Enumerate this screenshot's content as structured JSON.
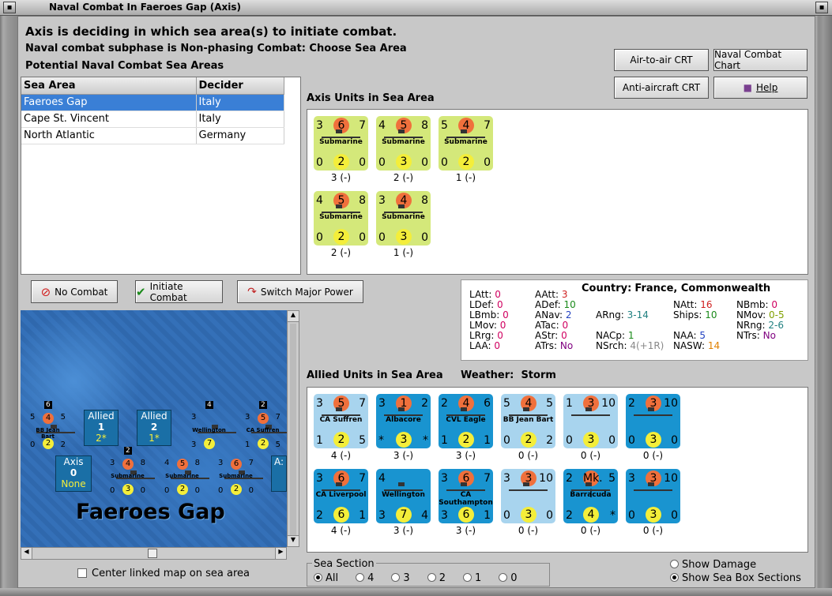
{
  "window": {
    "title": "Naval Combat In Faeroes Gap (Axis)"
  },
  "header": {
    "line1": "Axis is deciding in which sea area(s) to initiate combat.",
    "line2": "Naval combat subphase is Non-phasing Combat: Choose Sea Area",
    "line3": "Potential Naval Combat Sea Areas"
  },
  "buttons": {
    "air_to_air": "Air-to-air CRT",
    "naval_chart": "Naval Combat Chart",
    "anti_aircraft": "Anti-aircraft CRT",
    "help": "Help",
    "no_combat": "No Combat",
    "initiate": "Initiate Combat",
    "switch_power": "Switch Major Power"
  },
  "sea_table": {
    "headers": [
      "Sea Area",
      "Decider"
    ],
    "rows": [
      {
        "area": "Faeroes Gap",
        "decider": "Italy"
      },
      {
        "area": "Cape St. Vincent",
        "decider": "Italy"
      },
      {
        "area": "North Atlantic",
        "decider": "Germany"
      }
    ]
  },
  "axis_units": {
    "title": "Axis Units in Sea Area",
    "units": [
      {
        "tl": "3",
        "tc": "6",
        "tr": "7",
        "name": "Submarine",
        "bl": "0",
        "bc": "2",
        "br": "0",
        "under": "3 (-)"
      },
      {
        "tl": "4",
        "tc": "5",
        "tr": "8",
        "name": "Submarine",
        "bl": "0",
        "bc": "3",
        "br": "0",
        "under": "2 (-)"
      },
      {
        "tl": "5",
        "tc": "4",
        "tr": "7",
        "name": "Submarine",
        "bl": "0",
        "bc": "2",
        "br": "0",
        "under": "1 (-)"
      },
      {
        "tl": "4",
        "tc": "5",
        "tr": "8",
        "name": "Submarine",
        "bl": "0",
        "bc": "2",
        "br": "0",
        "under": "2 (-)"
      },
      {
        "tl": "3",
        "tc": "4",
        "tr": "8",
        "name": "Submarine",
        "bl": "0",
        "bc": "3",
        "br": "0",
        "under": "1 (-)"
      }
    ]
  },
  "stats": {
    "country_label": "Country:",
    "country": "France, Commonwealth",
    "col1": [
      [
        "LAtt:",
        "0"
      ],
      [
        "LDef:",
        "0"
      ],
      [
        "LBmb:",
        "0"
      ],
      [
        "LMov:",
        "0"
      ],
      [
        "LRrg:",
        "0"
      ],
      [
        "LAA:",
        "0"
      ]
    ],
    "col2": [
      [
        "AAtt:",
        "3"
      ],
      [
        "ADef:",
        "10"
      ],
      [
        "ANav:",
        "2"
      ],
      [
        "ATac:",
        "0"
      ],
      [
        "AStr:",
        "0"
      ],
      [
        "ATrs:",
        "No"
      ]
    ],
    "col3": [
      [
        "ARng:",
        "3-14"
      ],
      [
        "NACp:",
        "1"
      ],
      [
        "NSrch:",
        "4(+1R)"
      ]
    ],
    "col4": [
      [
        "NAtt:",
        "16"
      ],
      [
        "Ships:",
        "10"
      ],
      [
        "NAA:",
        "5"
      ],
      [
        "NASW:",
        "14"
      ]
    ],
    "col5": [
      [
        "NBmb:",
        "0"
      ],
      [
        "NMov:",
        "0-5"
      ],
      [
        "NRng:",
        "2-6"
      ],
      [
        "NTrs:",
        "No"
      ]
    ]
  },
  "allied_units": {
    "title": "Allied Units in Sea Area",
    "weather_label": "Weather:",
    "weather": "Storm",
    "units": [
      {
        "tl": "3",
        "tc": "5",
        "tr": "7",
        "name": "CA Suffren",
        "bl": "1",
        "bc": "2",
        "br": "5",
        "under": "4 (-)",
        "style": "lb"
      },
      {
        "tl": "3",
        "tc": "1",
        "tr": "2",
        "name": "Albacore",
        "bl": "*",
        "bc": "3",
        "br": "*",
        "under": "3 (-)",
        "style": "db"
      },
      {
        "tl": "2",
        "tc": "4",
        "tr": "6",
        "name": "CVL Eagle",
        "bl": "1",
        "bc": "2",
        "br": "1",
        "under": "3 (-)",
        "style": "db"
      },
      {
        "tl": "5",
        "tc": "4",
        "tr": "5",
        "name": "BB Jean Bart",
        "bl": "0",
        "bc": "2",
        "br": "2",
        "under": "0 (-)",
        "style": "lb"
      },
      {
        "tl": "1",
        "tc": "3",
        "tr": "10",
        "name": "",
        "bl": "0",
        "bc": "3",
        "br": "0",
        "under": "0 (-)",
        "style": "lb"
      },
      {
        "tl": "2",
        "tc": "3",
        "tr": "10",
        "name": "",
        "bl": "0",
        "bc": "3",
        "br": "0",
        "under": "0 (-)",
        "style": "db"
      },
      {
        "tl": "3",
        "tc": "6",
        "tr": "7",
        "name": "CA Liverpool",
        "bl": "2",
        "bc": "6",
        "br": "1",
        "under": "4 (-)",
        "style": "db"
      },
      {
        "tl": "4",
        "tc": "",
        "tr": "",
        "name": "Wellington",
        "bl": "3",
        "bc": "7",
        "br": "4",
        "under": "3 (-)",
        "style": "db"
      },
      {
        "tl": "3",
        "tc": "6",
        "tr": "7",
        "name": "CA Southampton",
        "bl": "3",
        "bc": "6",
        "br": "1",
        "under": "3 (-)",
        "style": "db"
      },
      {
        "tl": "3",
        "tc": "3",
        "tr": "10",
        "name": "",
        "bl": "0",
        "bc": "3",
        "br": "0",
        "under": "0 (-)",
        "style": "lb"
      },
      {
        "tl": "2",
        "tc": "Mk. I",
        "tr": "5",
        "name": "Barracuda",
        "bl": "2",
        "bc": "4",
        "br": "*",
        "under": "0 (-)",
        "style": "db"
      },
      {
        "tl": "3",
        "tc": "3",
        "tr": "10",
        "name": "",
        "bl": "0",
        "bc": "3",
        "br": "0",
        "under": "0 (-)",
        "style": "db"
      }
    ]
  },
  "map": {
    "title": "Faeroes Gap",
    "allied1": "Allied",
    "allied1_num": "1",
    "allied1_sub": "2*",
    "allied2": "Allied",
    "allied2_num": "2",
    "allied2_sub": "1*",
    "axis": "Axis",
    "axis_num": "0",
    "axis_sub": "None",
    "cut_label": "A:"
  },
  "map_counters": [
    {
      "tl": "5",
      "tc": "4",
      "tr": "5",
      "name": "BB Jean Bart",
      "bl": "0",
      "bc": "2",
      "br": "2",
      "top": "6"
    },
    {
      "tl": "3",
      "tc": "",
      "tr": "",
      "name": "Wellington",
      "bl": "3",
      "bc": "7",
      "br": "",
      "top": "4"
    },
    {
      "tl": "3",
      "tc": "5",
      "tr": "7",
      "name": "CA Suffren",
      "bl": "1",
      "bc": "2",
      "br": "5",
      "top": "2"
    },
    {
      "tl": "3",
      "tc": "4",
      "tr": "8",
      "name": "Submarine",
      "bl": "0",
      "bc": "3",
      "br": "0",
      "top": "2"
    },
    {
      "tl": "4",
      "tc": "5",
      "tr": "8",
      "name": "Submarine",
      "bl": "0",
      "bc": "2",
      "br": "0",
      "top": ""
    },
    {
      "tl": "3",
      "tc": "6",
      "tr": "7",
      "name": "Submarine",
      "bl": "0",
      "bc": "2",
      "br": "0",
      "top": ""
    }
  ],
  "bottom": {
    "center_map": "Center linked map on sea area",
    "sea_section": "Sea Section",
    "sections": [
      "All",
      "4",
      "3",
      "2",
      "1",
      "0"
    ],
    "show_damage": "Show Damage",
    "show_boxes": "Show Sea Box Sections"
  }
}
